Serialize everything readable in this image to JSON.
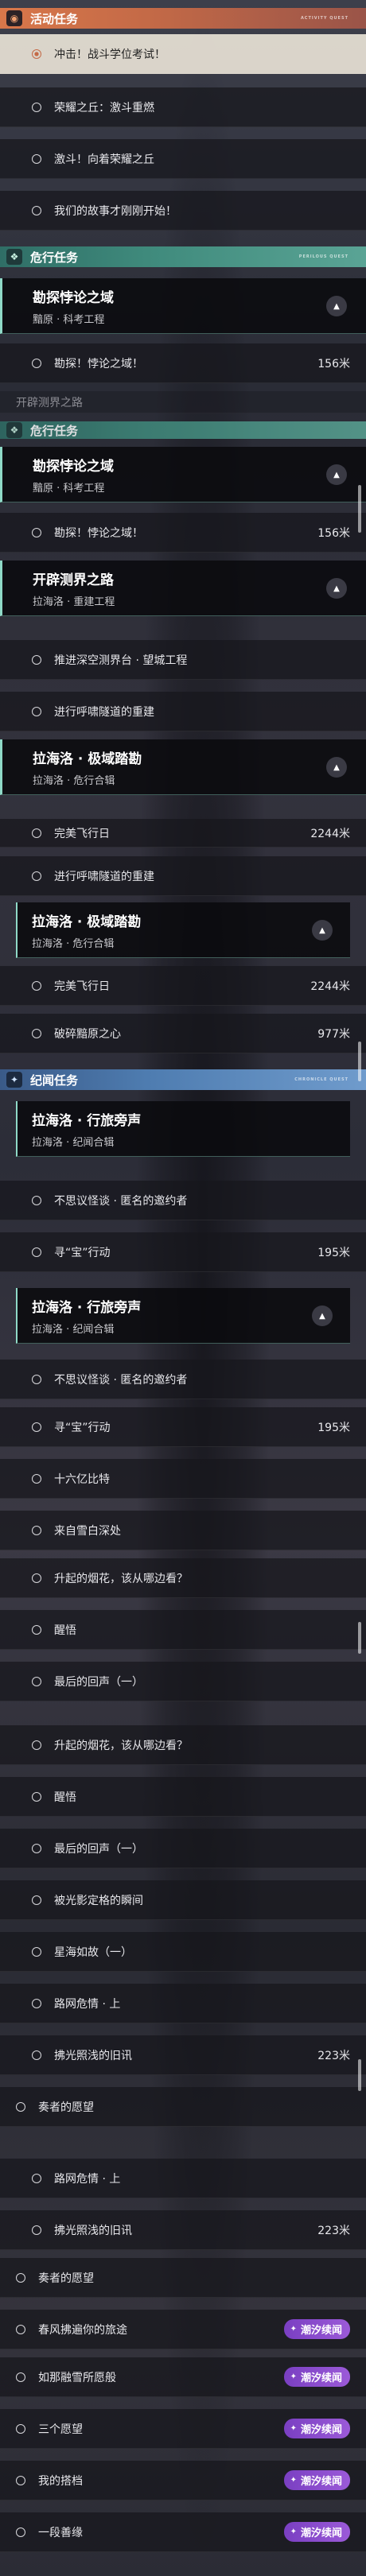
{
  "sections": {
    "activity": {
      "title": "活动任务",
      "tag": "ACTIVITY QUEST"
    },
    "danger": {
      "title": "危行任务",
      "tag": "PERILOUS QUEST"
    },
    "chronicle": {
      "title": "纪闻任务",
      "tag": "CHRONICLE QUEST"
    }
  },
  "quests": {
    "q1": "冲击！战斗学位考试！",
    "q2": "荣耀之丘：激斗重燃",
    "q3": "激斗！向着荣耀之丘",
    "q4": "我们的故事才刚刚开始！",
    "explore_title": "勘探悖论之域",
    "explore_sub": "黯原 · 科考工程",
    "explore_step": "勘探！悖论之域！",
    "explore_dist": "156米",
    "peek_text": "开辟测界之路",
    "frontier_title": "开辟测界之路",
    "frontier_sub": "拉海洛 · 重建工程",
    "frontier_step1": "推进深空测界台 · 望城工程",
    "frontier_step2": "进行呼啸隧道的重建",
    "extreme_title": "拉海洛 · 极域踏勘",
    "extreme_sub": "拉海洛 · 危行合辑",
    "extreme_step1": "完美飞行日",
    "extreme_dist1": "2244米",
    "extreme_step2": "破碎黯原之心",
    "extreme_dist2": "977米",
    "journey_title": "拉海洛 · 行旅旁声",
    "journey_sub": "拉海洛 · 纪闻合辑",
    "j1": "不思议怪谈 · 匿名的邀约者",
    "j2": "寻“宝”行动",
    "j2_dist": "195米",
    "j3": "十六亿比特",
    "j4": "来自雪白深处",
    "j5": "升起的烟花，该从哪边看？",
    "j6": "醒悟",
    "j7": "最后的回声（一）",
    "j8": "被光影定格的瞬间",
    "j9": "星海如故（一）",
    "j10": "路网危情 · 上",
    "j11": "拂光照浅的旧讯",
    "j11_dist": "223米",
    "j12": "奏者的愿望",
    "j13": "春风拂遍你的旅途",
    "j14": "如那融雪所愿般",
    "j15": "三个愿望",
    "j16": "我的搭档",
    "j17": "一段善缘"
  },
  "badge_label": "潮汐续闻",
  "icons": {
    "activity": "activity-icon",
    "danger": "danger-icon",
    "chronicle": "chronicle-icon",
    "badge": "tide-icon"
  }
}
